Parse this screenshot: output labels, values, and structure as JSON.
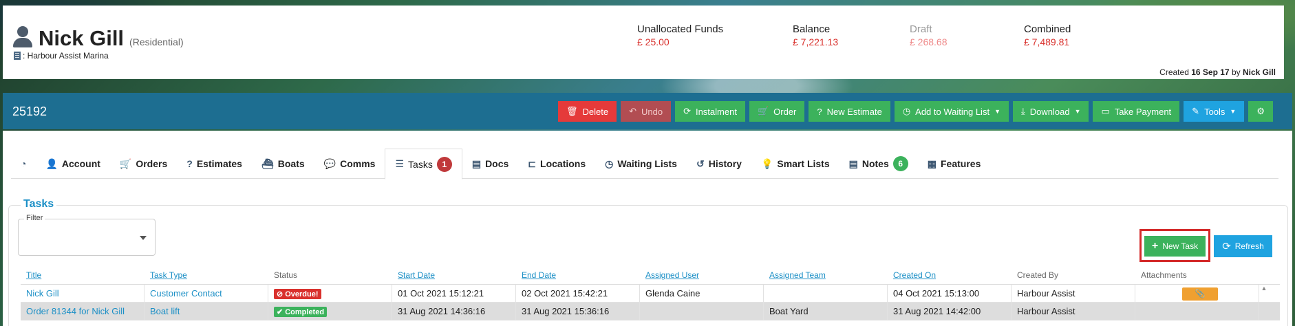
{
  "customer": {
    "name": "Nick Gill",
    "type": "(Residential)",
    "marina": ": Harbour Assist Marina"
  },
  "funds": {
    "unallocated_label": "Unallocated Funds",
    "unallocated_value": "£ 25.00",
    "balance_label": "Balance",
    "balance_value": "£ 7,221.13",
    "draft_label": "Draft",
    "draft_value": "£ 268.68",
    "combined_label": "Combined",
    "combined_value": "£ 7,489.81"
  },
  "created": {
    "prefix": "Created",
    "date": "16 Sep 17",
    "by": "by",
    "user": "Nick Gill"
  },
  "account_number": "25192",
  "actions": {
    "delete": "Delete",
    "undo": "Undo",
    "instalment": "Instalment",
    "order": "Order",
    "new_estimate": "New Estimate",
    "add_waiting": "Add to Waiting List",
    "download": "Download",
    "take_payment": "Take Payment",
    "tools": "Tools"
  },
  "tabs": {
    "account": "Account",
    "orders": "Orders",
    "estimates": "Estimates",
    "boats": "Boats",
    "comms": "Comms",
    "tasks": "Tasks",
    "tasks_count": "1",
    "docs": "Docs",
    "locations": "Locations",
    "waiting_lists": "Waiting Lists",
    "history": "History",
    "smart_lists": "Smart Lists",
    "notes": "Notes",
    "notes_count": "6",
    "features": "Features"
  },
  "tasks_panel": {
    "legend": "Tasks",
    "filter_label": "Filter",
    "new_task": "New Task",
    "refresh": "Refresh"
  },
  "table": {
    "headers": {
      "title": "Title",
      "task_type": "Task Type",
      "status": "Status",
      "start_date": "Start Date",
      "end_date": "End Date",
      "assigned_user": "Assigned User",
      "assigned_team": "Assigned Team",
      "created_on": "Created On",
      "created_by": "Created By",
      "attachments": "Attachments"
    },
    "rows": [
      {
        "title": "Nick Gill",
        "task_type": "Customer Contact",
        "status": "Overdue!",
        "start_date": "01 Oct 2021 15:12:21",
        "end_date": "02 Oct 2021 15:42:21",
        "assigned_user": "Glenda Caine",
        "assigned_team": "",
        "created_on": "04 Oct 2021 15:13:00",
        "created_by": "Harbour Assist"
      },
      {
        "title": "Order 81344 for Nick Gill",
        "task_type": "Boat lift",
        "status": "Completed",
        "start_date": "31 Aug 2021 14:36:16",
        "end_date": "31 Aug 2021 15:36:16",
        "assigned_user": "",
        "assigned_team": "Boat Yard",
        "created_on": "31 Aug 2021 14:42:00",
        "created_by": "Harbour Assist"
      }
    ]
  },
  "colors": {
    "accent_blue": "#1d6e91",
    "link_blue": "#1b8fc6",
    "danger_red": "#d9312d",
    "success_green": "#3cb25c",
    "info_blue": "#1fa3e0",
    "warning_orange": "#f0a030"
  }
}
